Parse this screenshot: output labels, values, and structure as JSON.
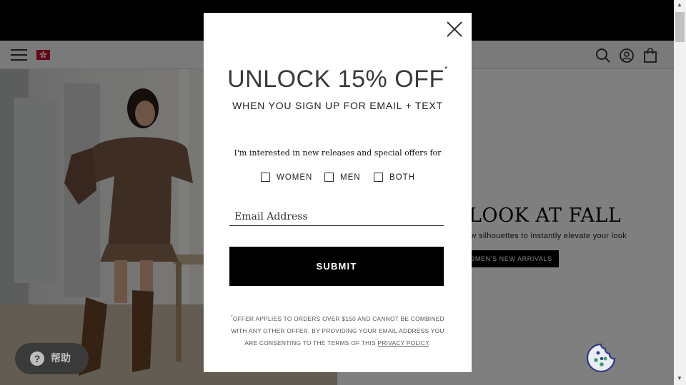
{
  "header": {
    "menu_icon": "hamburger-menu-icon",
    "flag_icon": "hong-kong-flag-icon",
    "icons": [
      "search-icon",
      "account-icon",
      "shopping-bag-icon"
    ]
  },
  "hero": {
    "title": "LOOK AT FALL",
    "subtitle": "ew silhouettes to instantly elevate your look",
    "button_label": "OMEN'S NEW ARRIVALS"
  },
  "modal": {
    "title": "UNLOCK 15% OFF",
    "title_mark": "*",
    "subtitle": "WHEN YOU SIGN UP FOR EMAIL + TEXT",
    "interest_prompt": "I'm interested in new releases and special offers for",
    "options": [
      "WOMEN",
      "MEN",
      "BOTH"
    ],
    "email_placeholder": "Email Address",
    "submit_label": "SUBMIT",
    "disclaimer_mark": "*",
    "disclaimer_text": "OFFER APPLIES TO ORDERS OVER $150 AND CANNOT BE COMBINED WITH ANY OTHER OFFER. BY PROVIDING YOUR EMAIL ADDRESS YOU ARE CONSENTING TO THE TERMS OF THIS ",
    "privacy_link": "PRIVACY POLICY",
    "disclaimer_end": "."
  },
  "help": {
    "icon_symbol": "?",
    "label": "帮助"
  },
  "colors": {
    "overlay": "#000000",
    "button": "#000000",
    "help_bg": "#3a3a3a"
  }
}
